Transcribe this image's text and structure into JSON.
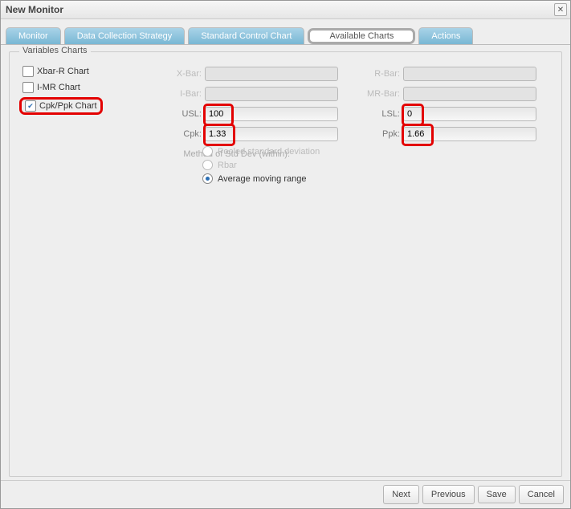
{
  "window": {
    "title": "New Monitor"
  },
  "tabs": {
    "monitor": "Monitor",
    "dcs": "Data Collection Strategy",
    "scc": "Standard Control Chart",
    "avail": "Available Charts",
    "actions": "Actions"
  },
  "fieldset": {
    "legend": "Variables Charts"
  },
  "chartOptions": {
    "xbarr": {
      "label": "Xbar-R Chart",
      "checked": false
    },
    "imr": {
      "label": "I-MR Chart",
      "checked": false
    },
    "cpk": {
      "label": "Cpk/Ppk Chart",
      "checked": true
    }
  },
  "fields": {
    "xbar": {
      "label": "X-Bar:",
      "value": ""
    },
    "ibar": {
      "label": "I-Bar:",
      "value": ""
    },
    "usl": {
      "label": "USL:",
      "value": "100"
    },
    "cpk": {
      "label": "Cpk:",
      "value": "1.33"
    },
    "rbar": {
      "label": "R-Bar:",
      "value": ""
    },
    "mrbar": {
      "label": "MR-Bar:",
      "value": ""
    },
    "lsl": {
      "label": "LSL:",
      "value": "0"
    },
    "ppk": {
      "label": "Ppk:",
      "value": "1.66"
    }
  },
  "stddev": {
    "label": "Method of Std Dev (within):",
    "options": {
      "pooled": "Pooled standard deviation",
      "rbar": "Rbar",
      "amr": "Average moving range"
    },
    "selected": "amr"
  },
  "footer": {
    "next": "Next",
    "previous": "Previous",
    "save": "Save",
    "cancel": "Cancel"
  }
}
